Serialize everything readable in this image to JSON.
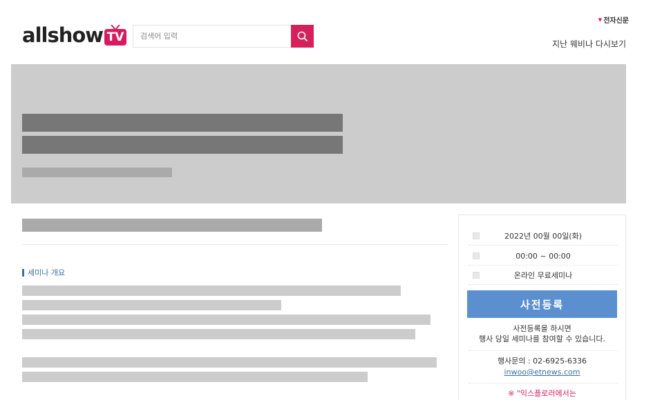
{
  "header": {
    "logo_text": "allshow",
    "logo_tv": "TV",
    "search_placeholder": "검색어 입력",
    "partner_name": "전자신문",
    "replay_link": "지난 웨비나 다시보기"
  },
  "main": {
    "section_heading": "세미나 개요"
  },
  "sidebar": {
    "date": "2022년 00월 00일(화)",
    "time": "00:00 ~ 00:00",
    "type": "온라인 무료세미나",
    "register_button": "사전등록",
    "register_note_line1": "사전등록을 하시면",
    "register_note_line2": "행사 당일 세미나를 참여할 수 있습니다.",
    "contact": "행사문의 : 02-6925-6336",
    "email": "inwoo@etnews.com",
    "warning": "※ \"익스플로러에서는"
  },
  "colors": {
    "brand": "#d6205b",
    "accent_blue": "#5b8fd0",
    "link_blue": "#3a6ea5",
    "banner_bg": "#cccccc",
    "placeholder_dark": "#777777",
    "placeholder_light": "#aaaaaa"
  }
}
